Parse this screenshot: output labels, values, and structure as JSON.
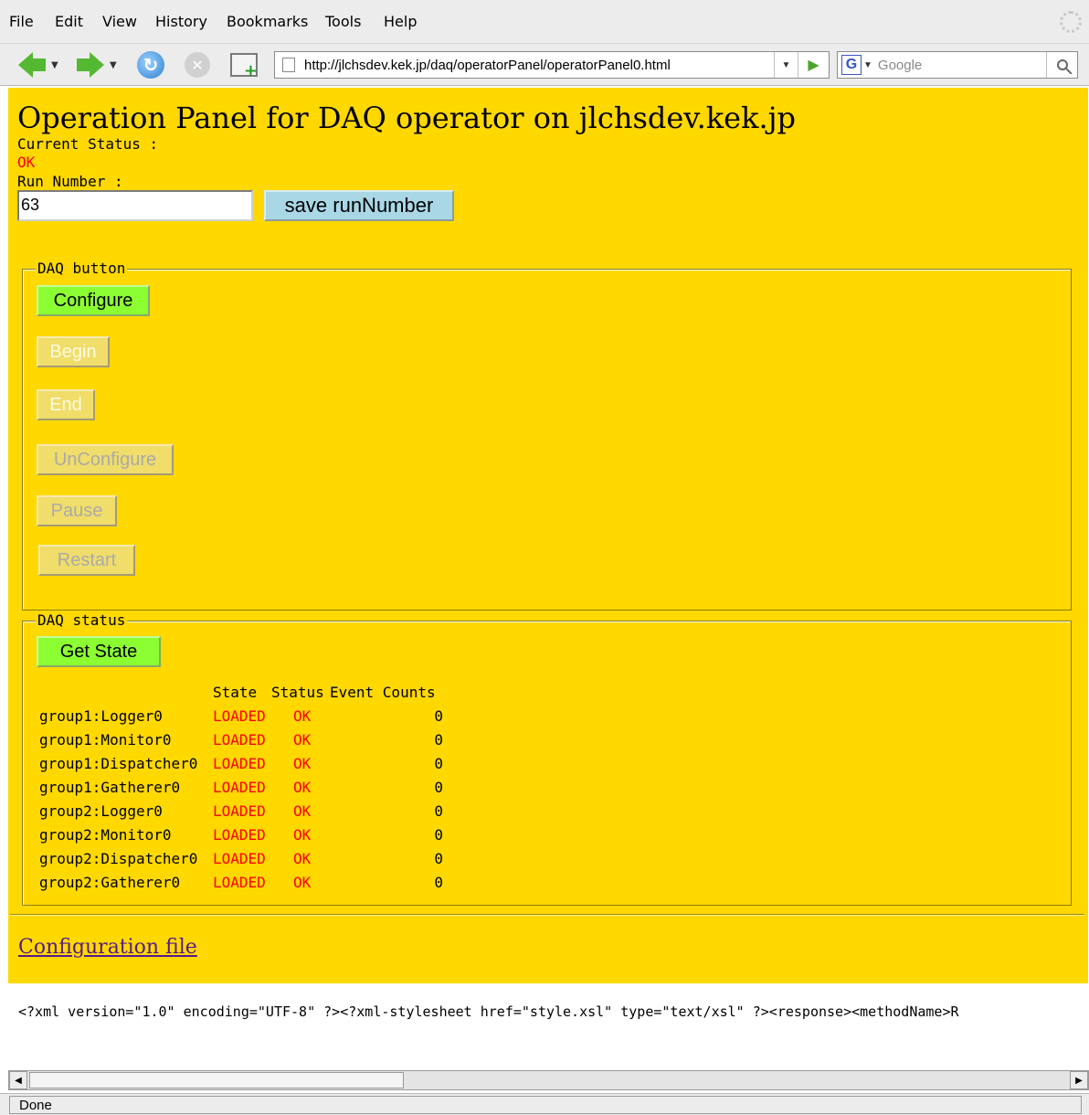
{
  "menubar": {
    "items": [
      {
        "label": "File"
      },
      {
        "label": "Edit"
      },
      {
        "label": "View"
      },
      {
        "label": "History"
      },
      {
        "label": "Bookmarks"
      },
      {
        "label": "Tools"
      },
      {
        "label": "Help"
      }
    ]
  },
  "toolbar": {
    "url": "http://jlchsdev.kek.jp/daq/operatorPanel/operatorPanel0.html",
    "search_placeholder": "Google",
    "search_engine_letter": "G",
    "icons": [
      "back-arrow-icon",
      "forward-arrow-icon",
      "reload-icon",
      "stop-icon",
      "new-tab-icon",
      "page-icon",
      "go-icon",
      "google-icon",
      "magnifier-icon"
    ]
  },
  "page": {
    "title": "Operation Panel for DAQ operator on jlchsdev.kek.jp",
    "current_status_label": "Current Status :",
    "current_status_value": "OK",
    "run_number_label": "Run Number :",
    "run_number_value": "63",
    "save_button": "save runNumber",
    "daq_button_legend": "DAQ button",
    "buttons": {
      "configure": "Configure",
      "begin": "Begin",
      "end": "End",
      "unconfigure": "UnConfigure",
      "pause": "Pause",
      "restart": "Restart"
    },
    "daq_status_legend": "DAQ status",
    "get_state_button": "Get State",
    "status_table": {
      "headers": [
        "",
        "State",
        "Status",
        "Event Counts"
      ],
      "rows": [
        {
          "name": "group1:Logger0",
          "state": "LOADED",
          "status": "OK",
          "count": "0"
        },
        {
          "name": "group1:Monitor0",
          "state": "LOADED",
          "status": "OK",
          "count": "0"
        },
        {
          "name": "group1:Dispatcher0",
          "state": "LOADED",
          "status": "OK",
          "count": "0"
        },
        {
          "name": "group1:Gatherer0",
          "state": "LOADED",
          "status": "OK",
          "count": "0"
        },
        {
          "name": "group2:Logger0",
          "state": "LOADED",
          "status": "OK",
          "count": "0"
        },
        {
          "name": "group2:Monitor0",
          "state": "LOADED",
          "status": "OK",
          "count": "0"
        },
        {
          "name": "group2:Dispatcher0",
          "state": "LOADED",
          "status": "OK",
          "count": "0"
        },
        {
          "name": "group2:Gatherer0",
          "state": "LOADED",
          "status": "OK",
          "count": "0"
        }
      ]
    },
    "config_link": "Configuration file"
  },
  "xml_response": "<?xml version=\"1.0\" encoding=\"UTF-8\" ?><?xml-stylesheet href=\"style.xsl\" type=\"text/xsl\" ?><response><methodName>R",
  "statusbar": {
    "text": "Done"
  },
  "colors": {
    "page_bg": "#ffd800",
    "active_button": "#8cff32",
    "save_button": "#a9d7e6",
    "status_red": "#ff0000",
    "link": "#551a8b"
  }
}
